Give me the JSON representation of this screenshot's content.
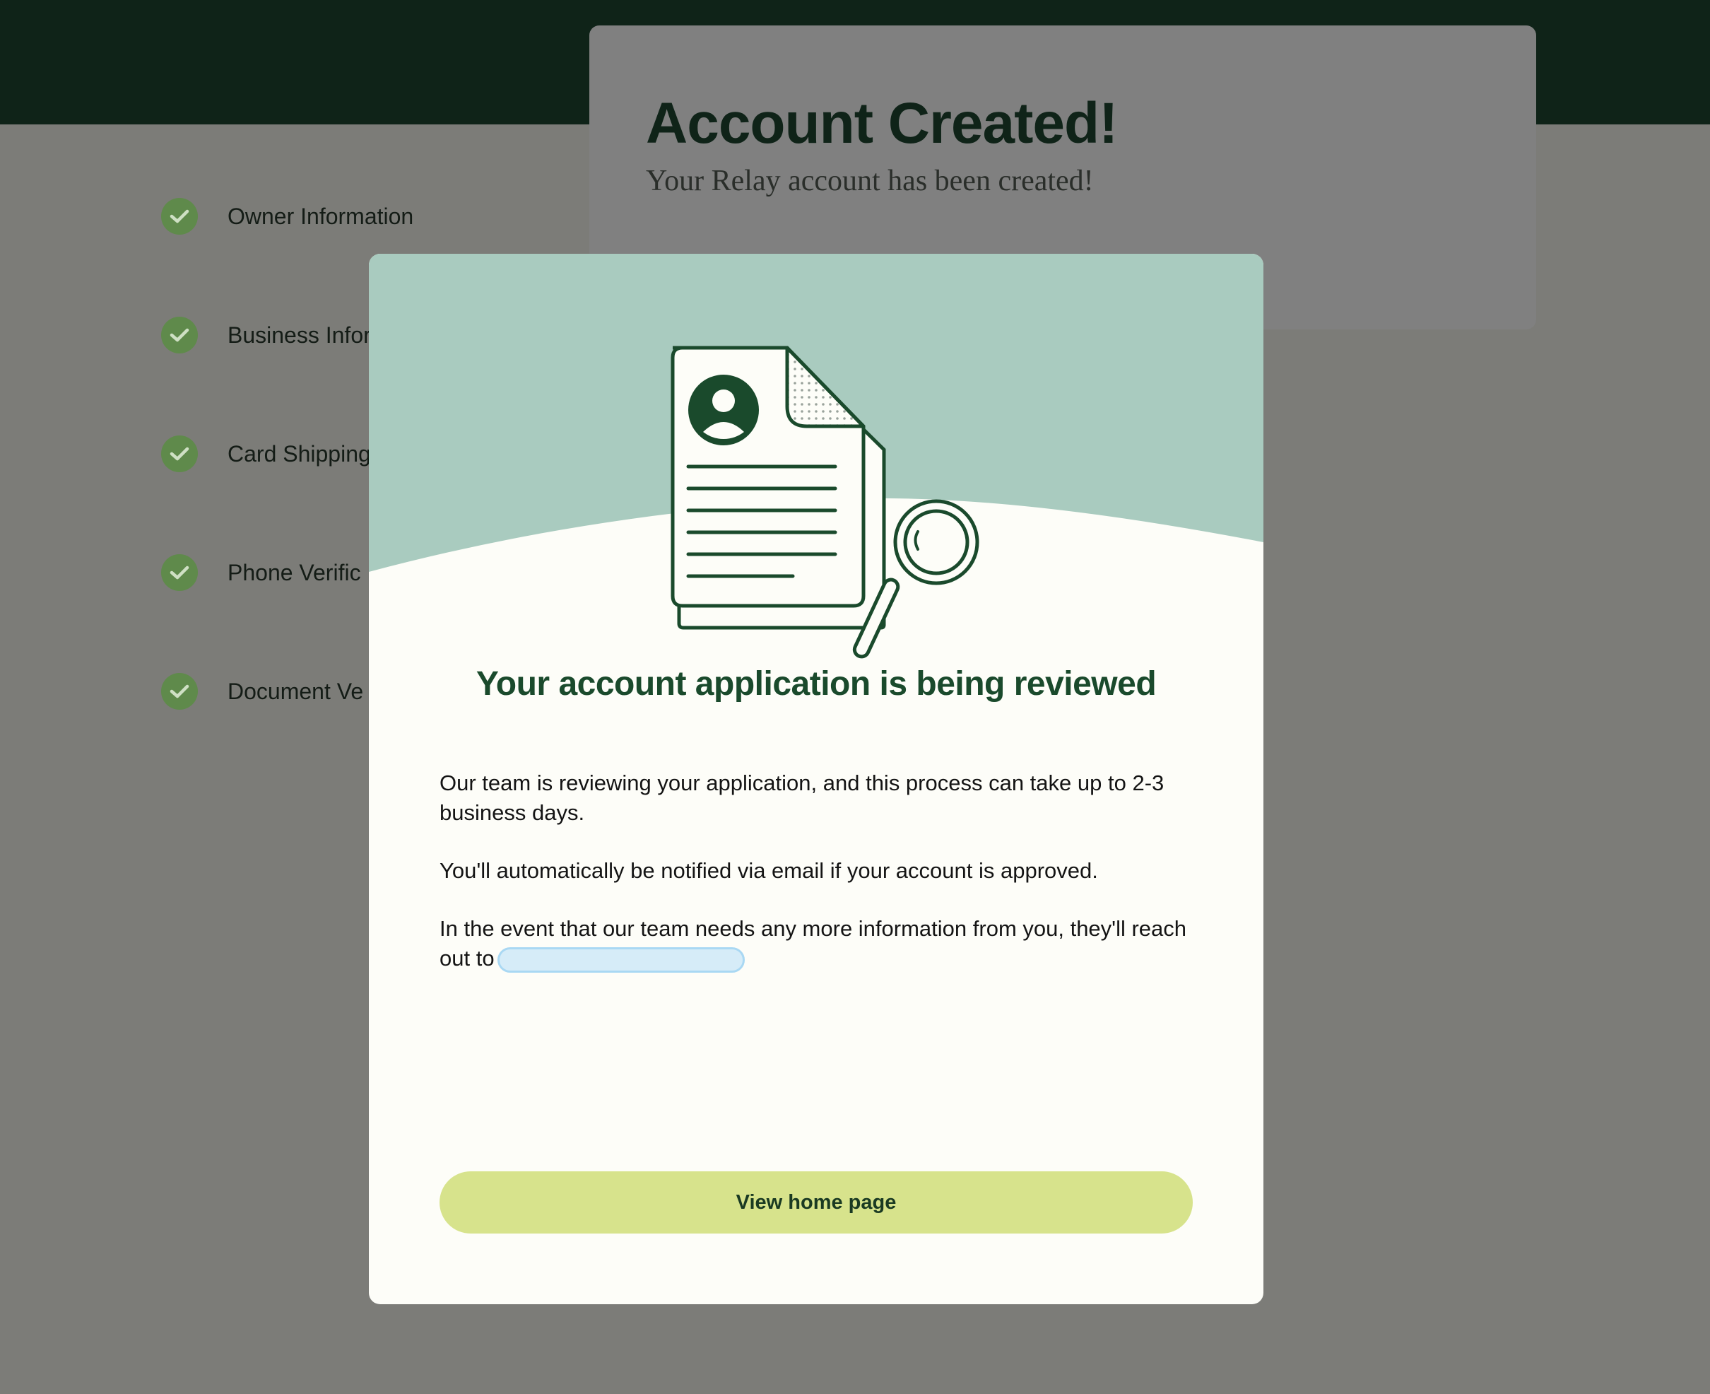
{
  "steps": [
    {
      "label": "Owner Information",
      "completed": true
    },
    {
      "label": "Business Infor",
      "completed": true
    },
    {
      "label": "Card Shipping",
      "completed": true
    },
    {
      "label": "Phone Verific",
      "completed": true
    },
    {
      "label": "Document Ve",
      "completed": true
    }
  ],
  "background_card": {
    "title": "Account Created!",
    "subtitle": "Your Relay account has been created!"
  },
  "modal": {
    "title": "Your account application is being reviewed",
    "paragraph_1": "Our team is reviewing your application, and this process can take up to 2-3 business days.",
    "paragraph_2": "You'll automatically be notified via email if your account is approved.",
    "paragraph_3": "In the event that our team needs any more information from you, they'll reach out to",
    "button_label": "View home page"
  },
  "colors": {
    "header_band": "#0f2318",
    "overlay": "#7c7c78",
    "hero_mint": "#a9cbbf",
    "brand_green": "#1a4a2c",
    "check_green": "#5f8a4b",
    "cta_lime": "#d7e38c",
    "email_highlight": "#d6ecf8"
  }
}
